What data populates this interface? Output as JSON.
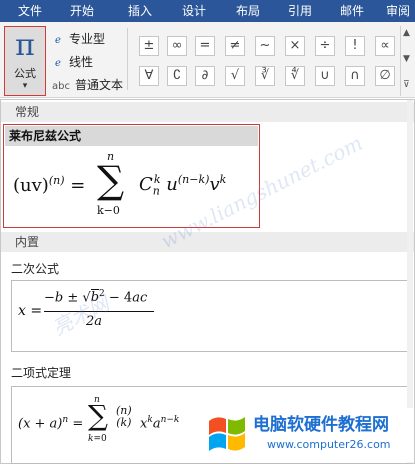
{
  "ribbon": {
    "tabs": [
      "文件",
      "开始",
      "插入",
      "设计",
      "布局",
      "引用",
      "邮件",
      "审阅"
    ],
    "equation_button": {
      "glyph": "π",
      "label": "公式"
    },
    "formats": [
      {
        "icon_text": "e",
        "label": "专业型"
      },
      {
        "icon_text": "e",
        "label": "线性"
      },
      {
        "icon_text": "abc",
        "label": "普通文本"
      }
    ],
    "symbols_row1": [
      "±",
      "∞",
      "=",
      "≠",
      "~",
      "×",
      "÷",
      "!",
      "∝",
      "<"
    ],
    "symbols_row2": [
      "∀",
      "∁",
      "∂",
      "√",
      "∛",
      "∜",
      "∪",
      "∩",
      "∅",
      "%"
    ]
  },
  "gallery": {
    "section_normal": "常规",
    "leibniz_title": "莱布尼兹公式",
    "section_builtin": "内置",
    "quadratic_title": "二次公式",
    "binomial_title": "二项式定理"
  },
  "logo": {
    "name": "电脑软硬件教程网",
    "url": "www.computer26.com"
  },
  "colors": {
    "ribbon_blue": "#2b579a",
    "highlight_red": "#d23a3a"
  }
}
